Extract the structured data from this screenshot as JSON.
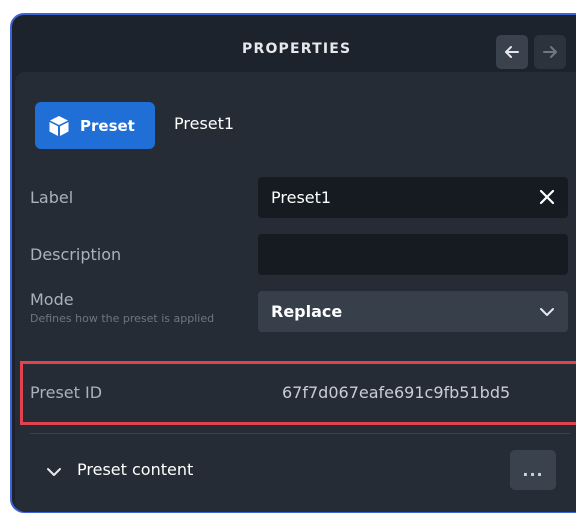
{
  "header": {
    "title": "PROPERTIES"
  },
  "node": {
    "type_label": "Preset",
    "name": "Preset1"
  },
  "fields": {
    "label": {
      "label": "Label",
      "value": "Preset1"
    },
    "description": {
      "label": "Description",
      "value": ""
    },
    "mode": {
      "label": "Mode",
      "hint": "Defines how the preset is applied",
      "value": "Replace"
    },
    "preset_id": {
      "label": "Preset ID",
      "value": "67f7d067eafe691c9fb51bd5"
    }
  },
  "section": {
    "title": "Preset content",
    "more_label": "..."
  },
  "colors": {
    "accent": "#1f6fd6",
    "highlight": "#e0434d",
    "panel": "#252c36",
    "frame_border": "#3f63d4"
  }
}
